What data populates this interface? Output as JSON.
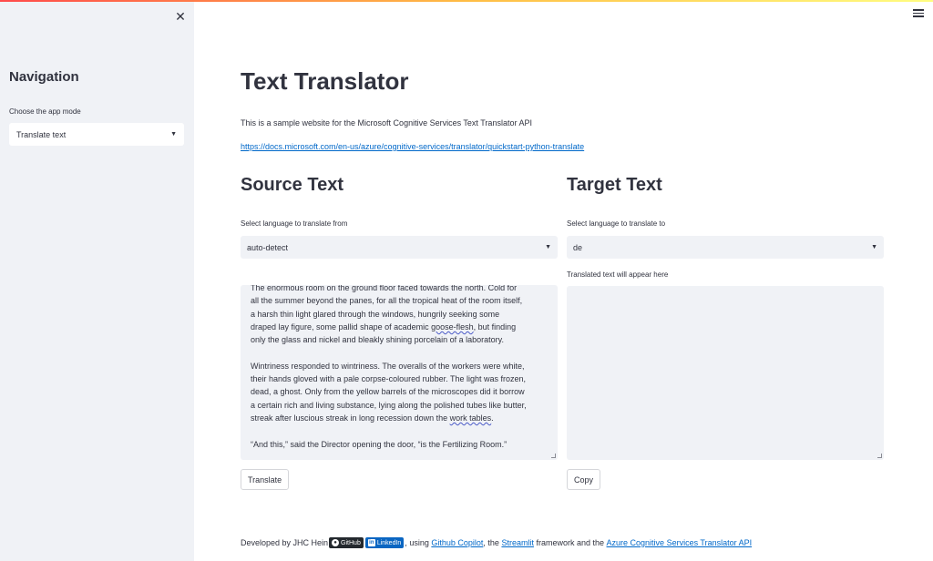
{
  "sidebar": {
    "title": "Navigation",
    "mode_label": "Choose the app mode",
    "mode_value": "Translate text"
  },
  "main": {
    "title": "Text Translator",
    "description": "This is a sample website for the Microsoft Cognitive Services Text Translator API",
    "doc_link": "https://docs.microsoft.com/en-us/azure/cognitive-services/translator/quickstart-python-translate"
  },
  "source": {
    "heading": "Source Text",
    "lang_label": "Select language to translate from",
    "lang_value": "auto-detect",
    "text": {
      "p1_l1": "The enormous room on the ground floor faced towards the north. Cold for",
      "p1_l2": "all the summer beyond the panes, for all the tropical heat of the room itself,",
      "p1_l3": "a harsh thin light glared through the windows, hungrily seeking some",
      "p1_l4a": "draped lay figure, some pallid shape of academic ",
      "p1_l4b": "goose-flesh",
      "p1_l4c": ", but finding",
      "p1_l5": "only the glass and nickel and bleakly shining porcelain of a laboratory.",
      "p2_l1": "Wintriness responded to wintriness. The overalls of the workers were white,",
      "p2_l2": "their hands gloved with a pale corpse-coloured rubber. The light was frozen,",
      "p2_l3": "dead, a ghost. Only from the yellow barrels of the microscopes did it borrow",
      "p2_l4": "a certain rich and living substance, lying along the polished tubes like butter,",
      "p2_l5a": "streak after luscious streak in long recession down the ",
      "p2_l5b": "work tables",
      "p2_l5c": ".",
      "p3": "“And this,” said the Director opening the door, “is the Fertilizing Room.”"
    },
    "button": "Translate"
  },
  "target": {
    "heading": "Target Text",
    "lang_label": "Select language to translate to",
    "lang_value": "de",
    "text_label": "Translated text will appear here",
    "button": "Copy"
  },
  "footer": {
    "prefix": "Developed by JHC Hein",
    "github_badge": "GitHub",
    "linkedin_badge": "LinkedIn",
    "using": ", using",
    "copilot": "Github Copilot",
    "the": ", the",
    "streamlit": "Streamlit",
    "framework": "framework and the",
    "azure": "Azure Cognitive Services Translator API"
  },
  "colors": {
    "accent_link": "#0068c9",
    "sidebar_bg": "#f0f2f6",
    "text": "#31333f"
  },
  "icons": {
    "close": "close-icon",
    "menu": "hamburger-menu-icon",
    "caret": "chevron-down-icon",
    "github": "github-icon",
    "linkedin": "linkedin-icon"
  }
}
